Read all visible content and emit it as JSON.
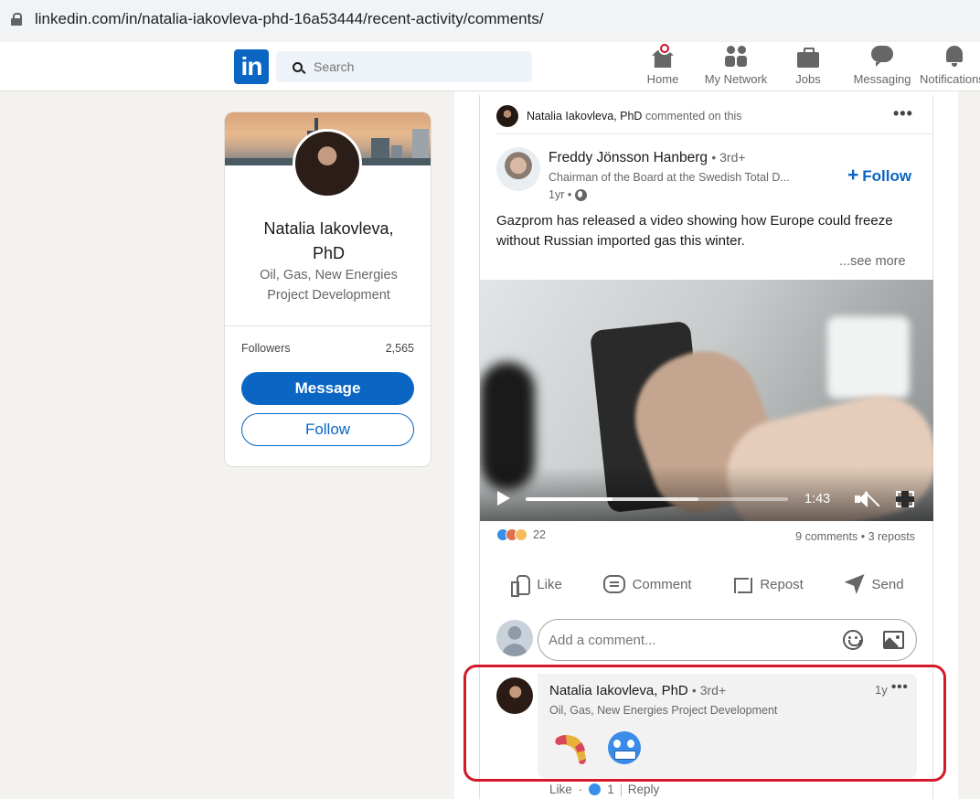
{
  "browser": {
    "url": "linkedin.com/in/natalia-iakovleva-phd-16a53444/recent-activity/comments/"
  },
  "header": {
    "logo": "in",
    "search_placeholder": "Search",
    "nav": [
      {
        "label": "Home",
        "icon": "home-icon"
      },
      {
        "label": "My Network",
        "icon": "my-network-icon"
      },
      {
        "label": "Jobs",
        "icon": "jobs-icon"
      },
      {
        "label": "Messaging",
        "icon": "messaging-icon"
      },
      {
        "label": "Notifications",
        "icon": "notifications-icon"
      }
    ],
    "accent": "#0a66c2",
    "badge_color": "#cb112d"
  },
  "profile": {
    "name": "Natalia Iakovleva, PhD",
    "headline": "Oil, Gas, New Energies Project Development",
    "followers_label": "Followers",
    "followers_count": "2,565",
    "message_label": "Message",
    "follow_label": "Follow"
  },
  "post": {
    "context_name": "Natalia Iakovleva, PhD",
    "context_action": "commented on this",
    "author_name": "Freddy Jönsson Hanberg",
    "author_degree": "• 3rd+",
    "author_headline": "Chairman of the Board at the Swedish Total D...",
    "time": "1yr •",
    "follow_label": "Follow",
    "text": "Gazprom has released a video showing how Europe could freeze without Russian imported gas this winter.",
    "see_more": "...see more",
    "video": {
      "duration": "1:43",
      "progress": 0.33,
      "buffered": 0.66
    },
    "reaction_count": "22",
    "comments": "9 comments",
    "reposts": "3 reposts",
    "actions": {
      "like": "Like",
      "comment": "Comment",
      "repost": "Repost",
      "send": "Send"
    },
    "comment_placeholder": "Add a comment..."
  },
  "comment": {
    "name": "Natalia Iakovleva, PhD",
    "degree": "• 3rd+",
    "headline": "Oil, Gas, New Energies Project Development",
    "time": "1y",
    "emojis": [
      "boomerang-emoji",
      "cold-face-emoji"
    ],
    "like_label": "Like",
    "like_count": "1",
    "reply_label": "Reply",
    "highlight_color": "#d3192a"
  }
}
